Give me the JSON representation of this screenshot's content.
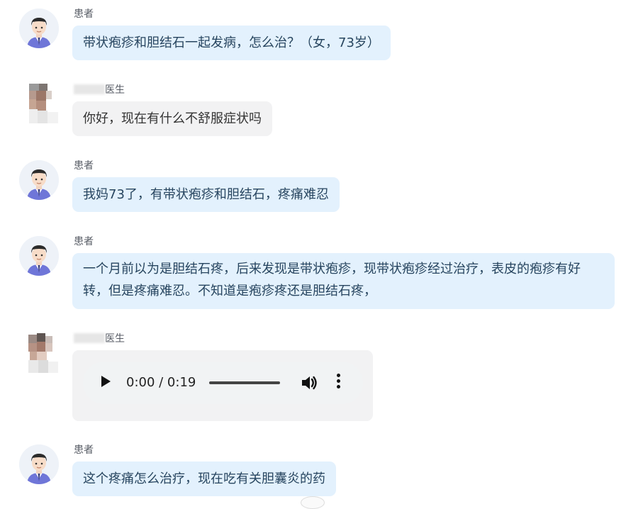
{
  "labels": {
    "patient": "患者",
    "doctor_suffix": "医生"
  },
  "messages": [
    {
      "id": "m1",
      "sender": "patient",
      "text": "带状疱疹和胆结石一起发病，怎么治？（女，73岁）"
    },
    {
      "id": "m2",
      "sender": "doctor",
      "text": "你好，现在有什么不舒服症状吗"
    },
    {
      "id": "m3",
      "sender": "patient",
      "text": "我妈73了，有带状疱疹和胆结石，疼痛难忍"
    },
    {
      "id": "m4",
      "sender": "patient",
      "text": "一个月前以为是胆结石疼，后来发现是带状疱疹，现带状疱疹经过治疗，表皮的疱疹有好转，但是疼痛难忍。不知道是疱疹疼还是胆结石疼，"
    },
    {
      "id": "m5",
      "sender": "doctor",
      "type": "audio",
      "time": "0:00 / 0:19"
    },
    {
      "id": "m6",
      "sender": "patient",
      "text": "这个疼痛怎么治疗，现在吃有关胆囊炎的药"
    }
  ],
  "colors": {
    "patient_bubble": "#e3f1fd",
    "doctor_bubble": "#f2f2f3",
    "avatar_shirt": "#6f76d8"
  },
  "icons": {
    "patient_avatar": "cartoon-man-avatar",
    "doctor_avatar": "pixelated-photo-avatar",
    "play": "play-icon",
    "volume": "volume-icon",
    "more": "more-vertical-icon"
  }
}
